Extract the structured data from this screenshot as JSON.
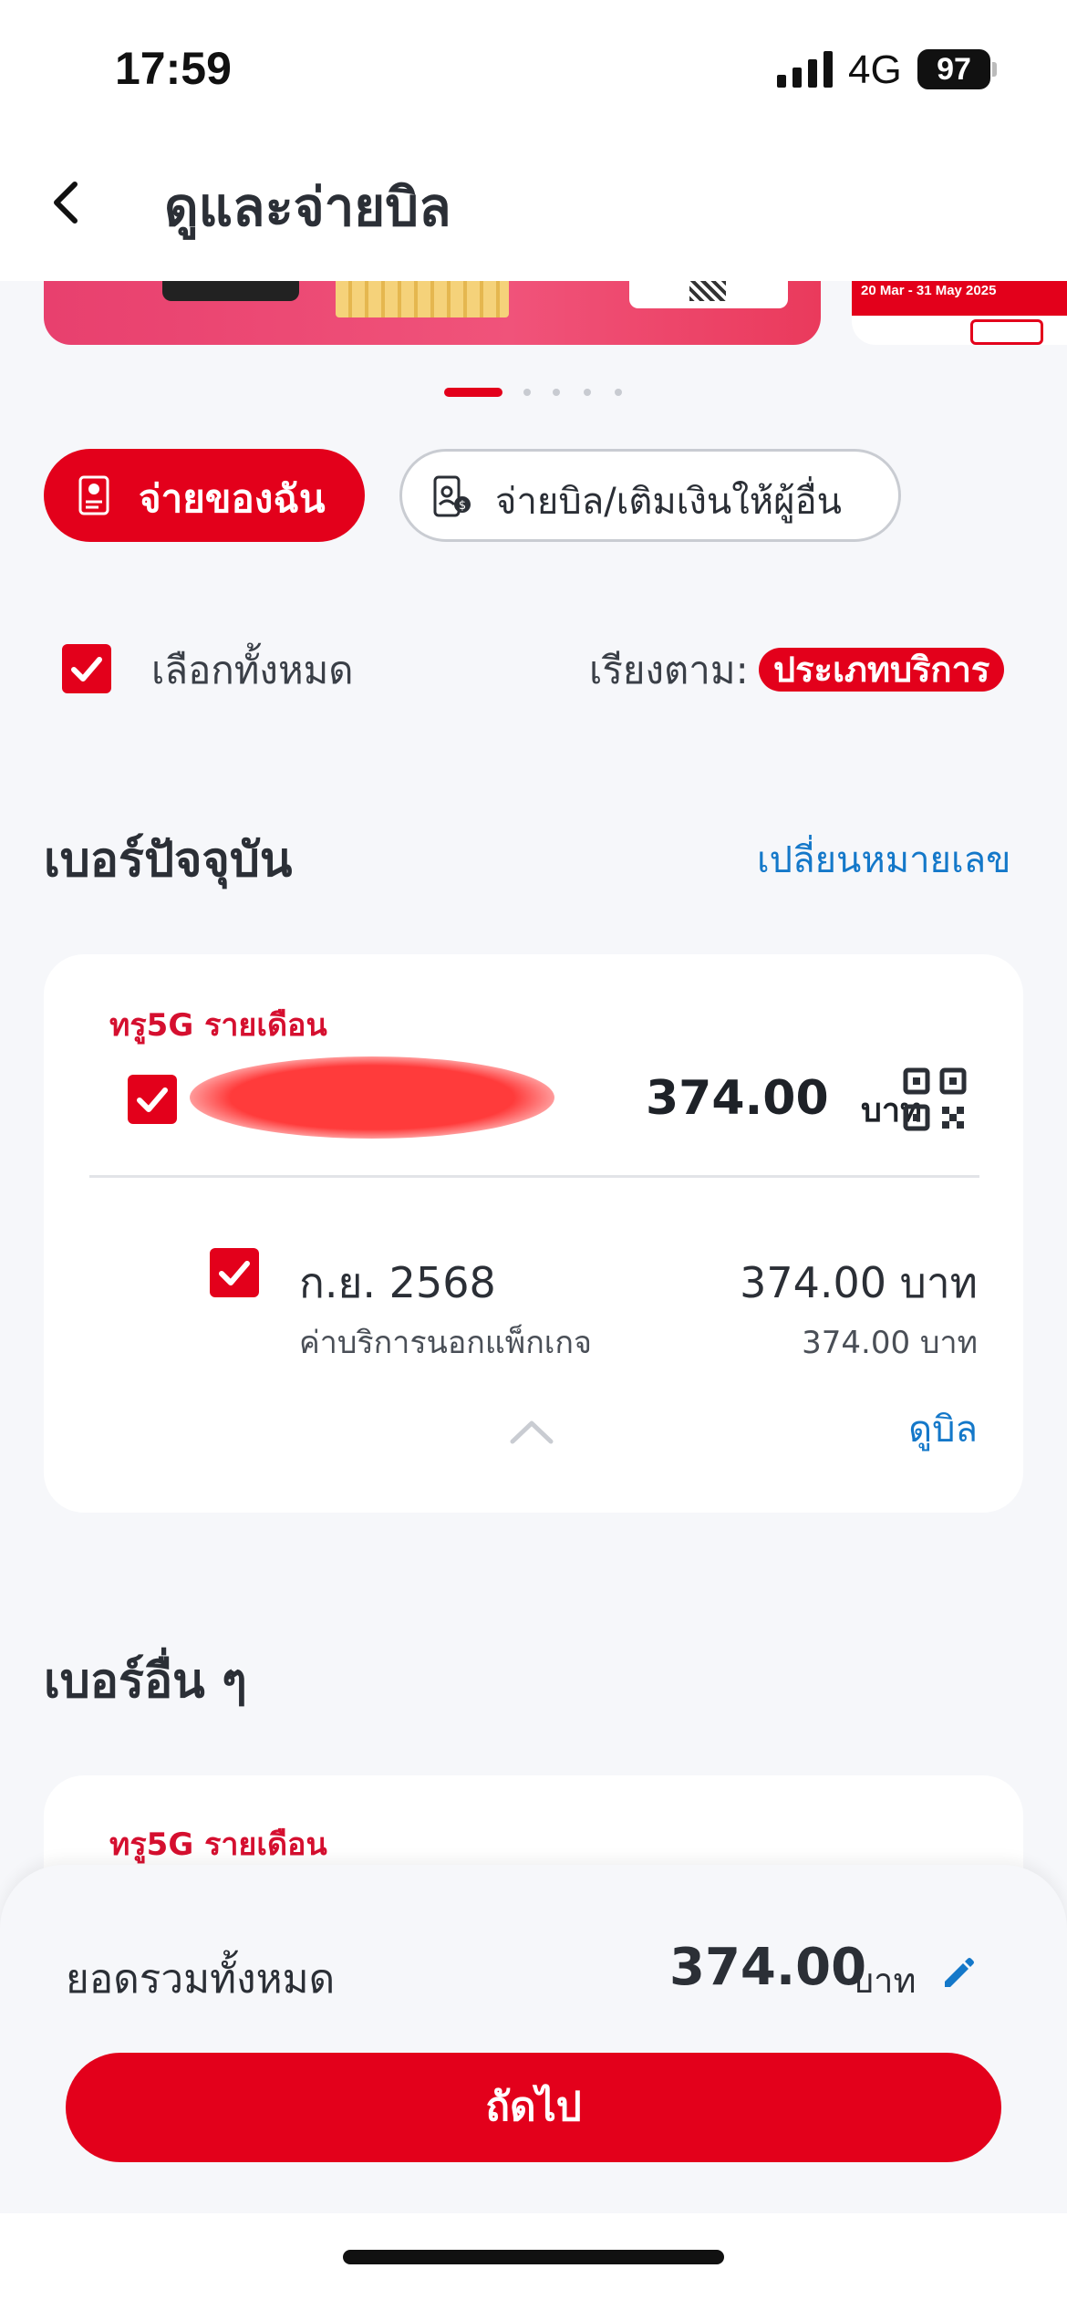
{
  "status_bar": {
    "time": "17:59",
    "network": "4G",
    "battery": "97"
  },
  "header": {
    "title": "ดูและจ่ายบิล",
    "back_icon": "chevron-left-icon"
  },
  "carousel": {
    "page_count": 5,
    "active_index": 0,
    "side_banner_text": "20 Mar - 31 May 2025"
  },
  "tabs": {
    "my_bills": {
      "label": "จ่ายของฉัน",
      "icon": "bill-icon",
      "active": true
    },
    "pay_others": {
      "label": "จ่ายบิล/เติมเงินให้ผู้อื่น",
      "icon": "phone-payment-icon",
      "active": false
    }
  },
  "selection": {
    "select_all_label": "เลือกทั้งหมด",
    "select_all_checked": true,
    "sort_label": "เรียงตาม:",
    "sort_value": "ประเภทบริการ"
  },
  "current_number": {
    "section_title": "เบอร์ปัจจุบัน",
    "change_number_label": "เปลี่ยนหมายเลข",
    "card": {
      "plan": "ทรู5G รายเดือน",
      "checked": true,
      "amount": "374.00",
      "unit": "บาท",
      "items": [
        {
          "period": "ก.ย. 2568",
          "description": "ค่าบริการนอกแพ็กเกจ",
          "amount": "374.00 บาท",
          "sub_amount": "374.00 บาท",
          "checked": true
        }
      ],
      "view_bill_label": "ดูบิล"
    }
  },
  "other_numbers": {
    "section_title": "เบอร์อื่น ๆ",
    "card": {
      "plan": "ทรู5G รายเดือน"
    }
  },
  "summary": {
    "total_label": "ยอดรวมทั้งหมด",
    "total_amount": "374.00",
    "unit": "บาท",
    "next_button": "ถัดไป"
  },
  "colors": {
    "brand_red": "#e3001b",
    "link_blue": "#1478c9",
    "plan_red": "#d50f2f",
    "background": "#f6f7fa"
  }
}
